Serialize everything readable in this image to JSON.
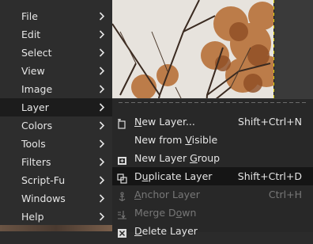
{
  "main_menu": {
    "items": [
      {
        "label": "File",
        "icon": "chevron-right-icon"
      },
      {
        "label": "Edit",
        "icon": "chevron-right-icon"
      },
      {
        "label": "Select",
        "icon": "chevron-right-icon"
      },
      {
        "label": "View",
        "icon": "chevron-right-icon"
      },
      {
        "label": "Image",
        "icon": "chevron-right-icon"
      },
      {
        "label": "Layer",
        "icon": "chevron-right-icon",
        "active": true
      },
      {
        "label": "Colors",
        "icon": "chevron-right-icon"
      },
      {
        "label": "Tools",
        "icon": "chevron-right-icon"
      },
      {
        "label": "Filters",
        "icon": "chevron-right-icon"
      },
      {
        "label": "Script-Fu",
        "icon": "chevron-right-icon"
      },
      {
        "label": "Windows",
        "icon": "chevron-right-icon"
      },
      {
        "label": "Help",
        "icon": "chevron-right-icon"
      }
    ]
  },
  "layer_submenu": {
    "items": [
      {
        "label": "New Layer...",
        "shortcut": "Shift+Ctrl+N",
        "icon": "new-layer-icon",
        "enabled": true
      },
      {
        "label": "New from Visible",
        "shortcut": "",
        "icon": "",
        "enabled": true
      },
      {
        "label": "New Layer Group",
        "shortcut": "",
        "icon": "layer-group-icon",
        "enabled": true
      },
      {
        "label": "Duplicate Layer",
        "shortcut": "Shift+Ctrl+D",
        "icon": "duplicate-layer-icon",
        "enabled": true,
        "active": true
      },
      {
        "label": "Anchor Layer",
        "shortcut": "Ctrl+H",
        "icon": "anchor-icon",
        "enabled": false
      },
      {
        "label": "Merge Down",
        "shortcut": "",
        "icon": "merge-down-icon",
        "enabled": false
      },
      {
        "label": "Delete Layer",
        "shortcut": "",
        "icon": "delete-layer-icon",
        "enabled": true
      }
    ]
  },
  "colors": {
    "menu_bg": "#2d2d2d",
    "submenu_bg": "#282828",
    "active_bg": "#1c1c1c",
    "text": "#e6e6e6",
    "disabled_text": "#777777"
  }
}
